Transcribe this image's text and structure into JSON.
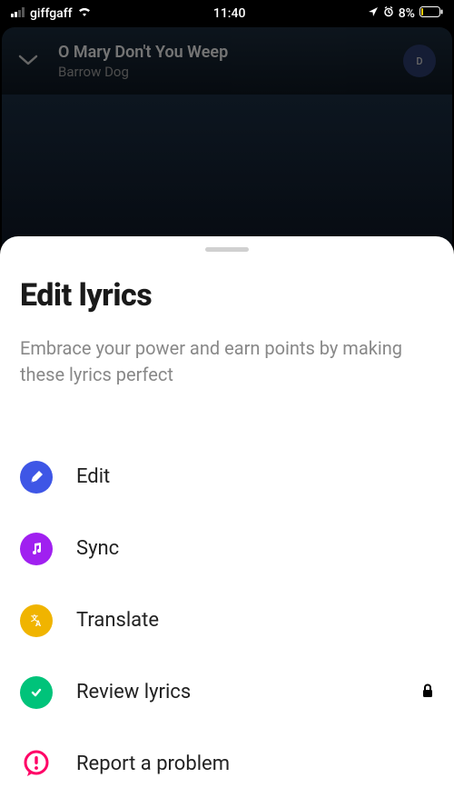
{
  "statusbar": {
    "carrier": "giffgaff",
    "time": "11:40",
    "battery": "8%"
  },
  "player": {
    "title": "O Mary Don't You Weep",
    "artist": "Barrow Dog",
    "avatar_letter": "D"
  },
  "sheet": {
    "title": "Edit lyrics",
    "subtitle": "Embrace your power and earn points by making these lyrics perfect",
    "options": {
      "edit": "Edit",
      "sync": "Sync",
      "translate": "Translate",
      "review": "Review lyrics",
      "report": "Report a problem"
    }
  }
}
